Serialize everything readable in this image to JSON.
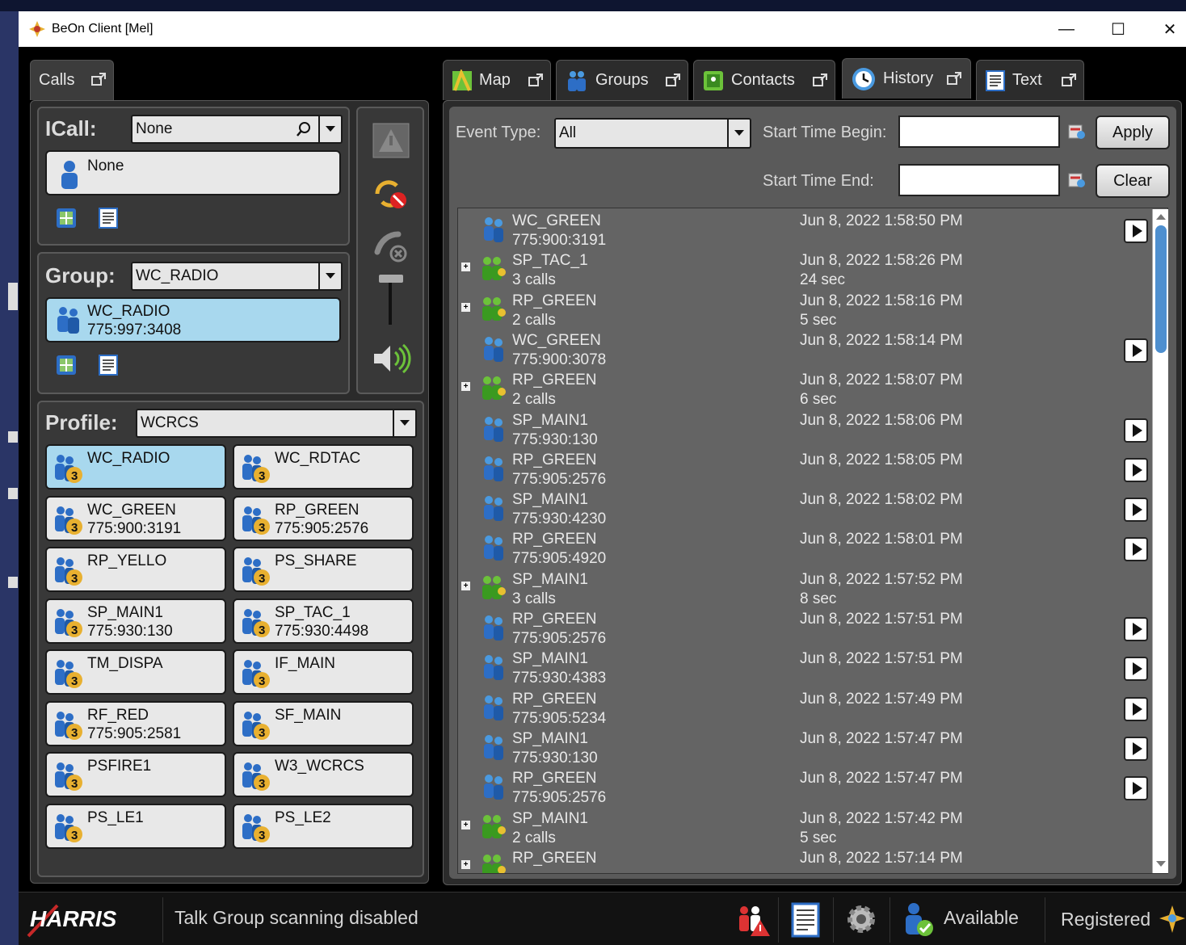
{
  "window": {
    "title": "BeOn Client [Mel]",
    "minimize": "—",
    "maximize": "☐",
    "close": "✕"
  },
  "left_tab": {
    "label": "Calls"
  },
  "icall": {
    "label": "ICall:",
    "combo_value": "None",
    "tile_name": "None"
  },
  "group": {
    "label": "Group:",
    "combo_value": "WC_RADIO",
    "tile_name": "WC_RADIO",
    "tile_id": "775:997:3408"
  },
  "profile": {
    "label": "Profile:",
    "combo_value": "WCRCS",
    "tiles": [
      {
        "name": "WC_RADIO",
        "id": "",
        "selected": true
      },
      {
        "name": "WC_RDTAC",
        "id": "",
        "selected": false
      },
      {
        "name": "WC_GREEN",
        "id": "775:900:3191",
        "selected": false
      },
      {
        "name": "RP_GREEN",
        "id": "775:905:2576",
        "selected": false
      },
      {
        "name": "RP_YELLO",
        "id": "",
        "selected": false
      },
      {
        "name": "PS_SHARE",
        "id": "",
        "selected": false
      },
      {
        "name": "SP_MAIN1",
        "id": "775:930:130",
        "selected": false
      },
      {
        "name": "SP_TAC_1",
        "id": "775:930:4498",
        "selected": false
      },
      {
        "name": "TM_DISPA",
        "id": "",
        "selected": false
      },
      {
        "name": "IF_MAIN",
        "id": "",
        "selected": false
      },
      {
        "name": "RF_RED",
        "id": "775:905:2581",
        "selected": false
      },
      {
        "name": "SF_MAIN",
        "id": "",
        "selected": false
      },
      {
        "name": "PSFIRE1",
        "id": "",
        "selected": false
      },
      {
        "name": "W3_WCRCS",
        "id": "",
        "selected": false
      },
      {
        "name": "PS_LE1",
        "id": "",
        "selected": false
      },
      {
        "name": "PS_LE2",
        "id": "",
        "selected": false
      }
    ]
  },
  "tabs": [
    {
      "label": "Map",
      "icon": "map-icon"
    },
    {
      "label": "Groups",
      "icon": "groups-icon"
    },
    {
      "label": "Contacts",
      "icon": "contacts-icon"
    },
    {
      "label": "History",
      "icon": "history-icon",
      "active": true
    },
    {
      "label": "Text",
      "icon": "text-icon"
    }
  ],
  "filters": {
    "event_type_label": "Event Type:",
    "event_type_value": "All",
    "start_begin_label": "Start Time Begin:",
    "start_end_label": "Start Time End:",
    "start_begin_value": "",
    "start_end_value": "",
    "apply": "Apply",
    "clear": "Clear"
  },
  "history": [
    {
      "name": "WC_GREEN",
      "sub": "775:900:3191",
      "time": "Jun 8, 2022 1:58:50 PM",
      "dur": "",
      "group": false,
      "play": true
    },
    {
      "name": "SP_TAC_1",
      "sub": "3 calls",
      "time": "Jun 8, 2022 1:58:26 PM",
      "dur": "24 sec",
      "group": true,
      "play": false
    },
    {
      "name": "RP_GREEN",
      "sub": "2 calls",
      "time": "Jun 8, 2022 1:58:16 PM",
      "dur": "5 sec",
      "group": true,
      "play": false
    },
    {
      "name": "WC_GREEN",
      "sub": "775:900:3078",
      "time": "Jun 8, 2022 1:58:14 PM",
      "dur": "",
      "group": false,
      "play": true
    },
    {
      "name": "RP_GREEN",
      "sub": "2 calls",
      "time": "Jun 8, 2022 1:58:07 PM",
      "dur": "6 sec",
      "group": true,
      "play": false
    },
    {
      "name": "SP_MAIN1",
      "sub": "775:930:130",
      "time": "Jun 8, 2022 1:58:06 PM",
      "dur": "",
      "group": false,
      "play": true
    },
    {
      "name": "RP_GREEN",
      "sub": "775:905:2576",
      "time": "Jun 8, 2022 1:58:05 PM",
      "dur": "",
      "group": false,
      "play": true
    },
    {
      "name": "SP_MAIN1",
      "sub": "775:930:4230",
      "time": "Jun 8, 2022 1:58:02 PM",
      "dur": "",
      "group": false,
      "play": true
    },
    {
      "name": "RP_GREEN",
      "sub": "775:905:4920",
      "time": "Jun 8, 2022 1:58:01 PM",
      "dur": "",
      "group": false,
      "play": true
    },
    {
      "name": "SP_MAIN1",
      "sub": "3 calls",
      "time": "Jun 8, 2022 1:57:52 PM",
      "dur": "8 sec",
      "group": true,
      "play": false
    },
    {
      "name": "RP_GREEN",
      "sub": "775:905:2576",
      "time": "Jun 8, 2022 1:57:51 PM",
      "dur": "",
      "group": false,
      "play": true
    },
    {
      "name": "SP_MAIN1",
      "sub": "775:930:4383",
      "time": "Jun 8, 2022 1:57:51 PM",
      "dur": "",
      "group": false,
      "play": true
    },
    {
      "name": "RP_GREEN",
      "sub": "775:905:5234",
      "time": "Jun 8, 2022 1:57:49 PM",
      "dur": "",
      "group": false,
      "play": true
    },
    {
      "name": "SP_MAIN1",
      "sub": "775:930:130",
      "time": "Jun 8, 2022 1:57:47 PM",
      "dur": "",
      "group": false,
      "play": true
    },
    {
      "name": "RP_GREEN",
      "sub": "775:905:2576",
      "time": "Jun 8, 2022 1:57:47 PM",
      "dur": "",
      "group": false,
      "play": true
    },
    {
      "name": "SP_MAIN1",
      "sub": "2 calls",
      "time": "Jun 8, 2022 1:57:42 PM",
      "dur": "5 sec",
      "group": true,
      "play": false
    },
    {
      "name": "RP_GREEN",
      "sub": "",
      "time": "Jun 8, 2022 1:57:14 PM",
      "dur": "",
      "group": true,
      "play": false
    }
  ],
  "status": {
    "brand": "HARRIS",
    "message": "Talk Group scanning disabled",
    "presence": "Available",
    "registration": "Registered"
  }
}
